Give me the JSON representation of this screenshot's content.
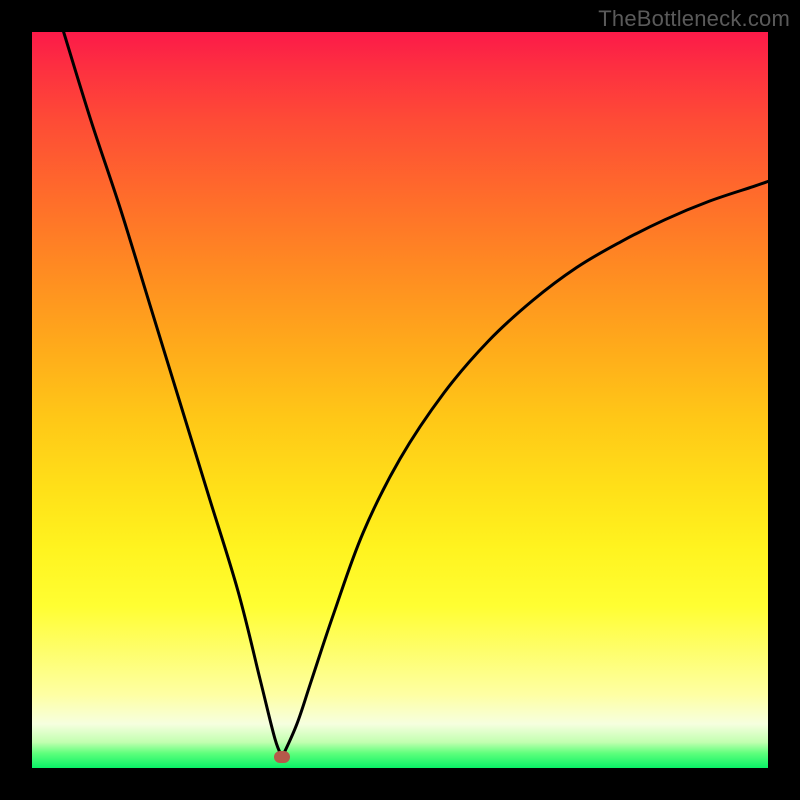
{
  "watermark": "TheBottleneck.com",
  "colors": {
    "background": "#000000",
    "curve": "#000000",
    "dot": "#b55a4a"
  },
  "chart_data": {
    "type": "line",
    "title": "",
    "xlabel": "",
    "ylabel": "",
    "xlim": [
      0,
      100
    ],
    "ylim": [
      0,
      100
    ],
    "grid": false,
    "legend": false,
    "annotations": [
      {
        "name": "minimum-marker",
        "x": 34,
        "y": 1.5
      }
    ],
    "series": [
      {
        "name": "left-branch",
        "x": [
          4.3,
          8,
          12,
          16,
          20,
          24,
          28,
          31,
          33,
          34
        ],
        "values": [
          100,
          88,
          76,
          63,
          50,
          37,
          24,
          12,
          4,
          1.5
        ]
      },
      {
        "name": "right-branch",
        "x": [
          34,
          36,
          38,
          41,
          45,
          50,
          56,
          62,
          68,
          74,
          80,
          86,
          92,
          98,
          100
        ],
        "values": [
          1.5,
          6,
          12,
          21,
          32,
          42,
          51,
          58,
          63.5,
          68,
          71.5,
          74.5,
          77,
          79,
          79.7
        ]
      }
    ]
  }
}
